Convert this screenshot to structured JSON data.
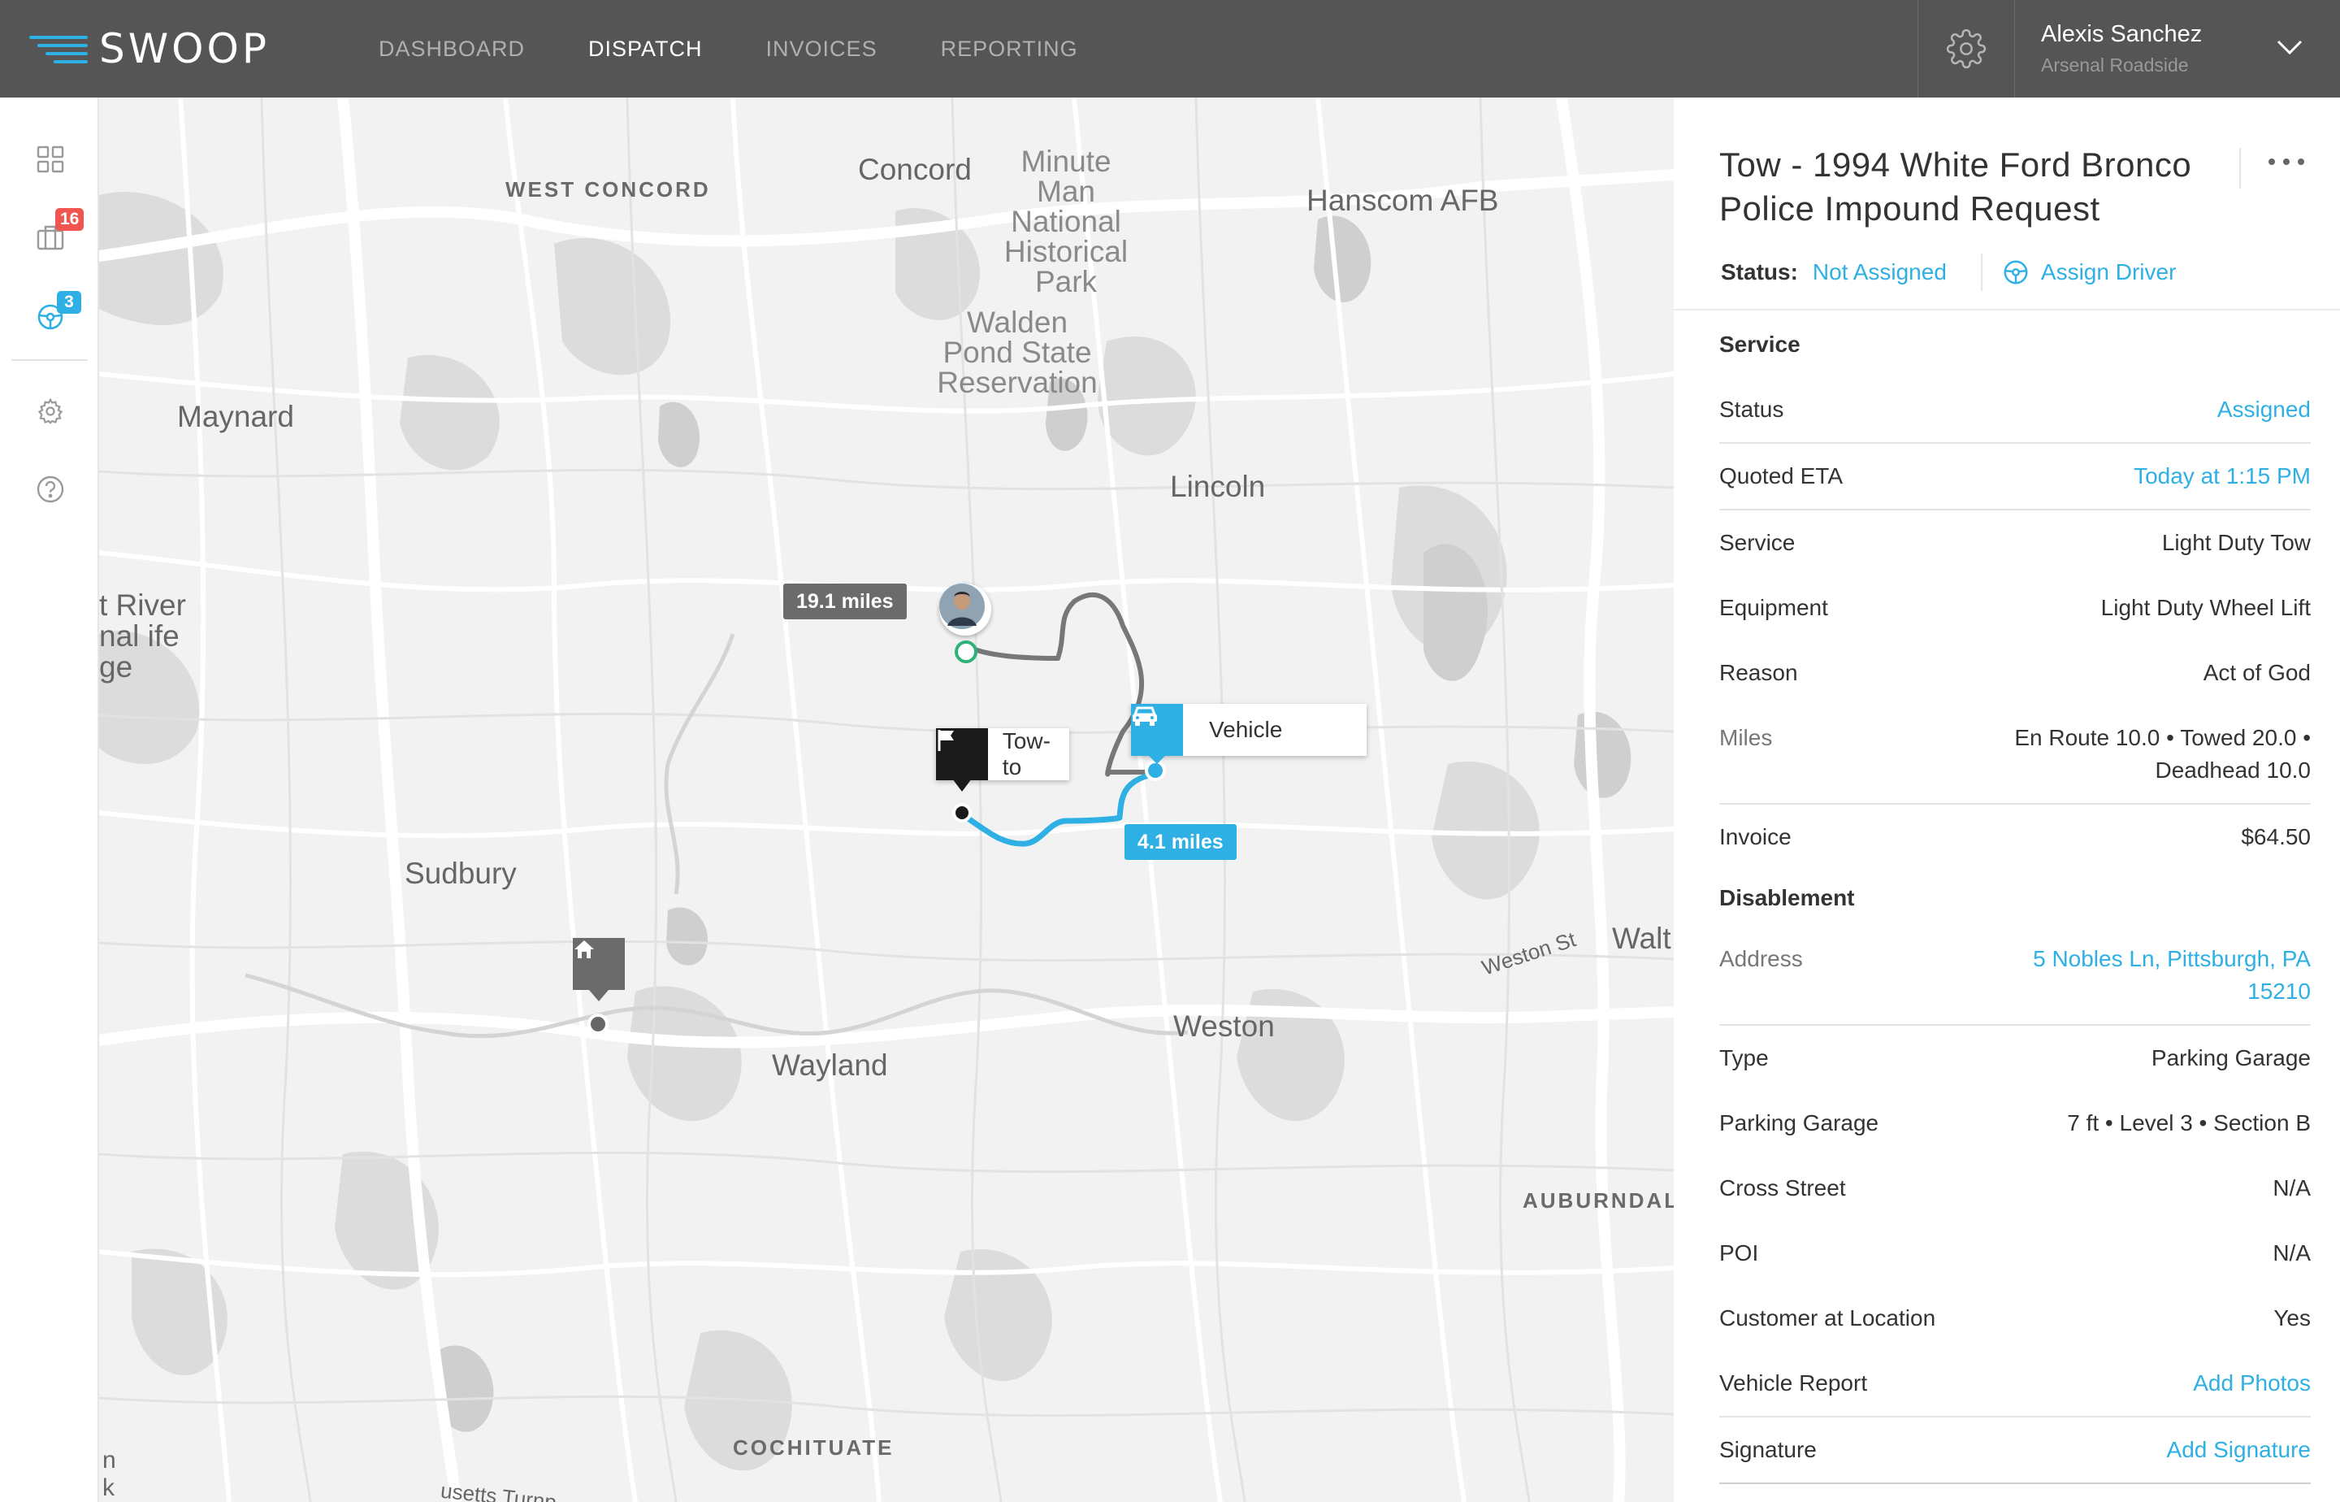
{
  "app": {
    "logo_text": "SWOOP"
  },
  "nav": {
    "items": [
      {
        "label": "DASHBOARD",
        "active": false
      },
      {
        "label": "DISPATCH",
        "active": true
      },
      {
        "label": "INVOICES",
        "active": false
      },
      {
        "label": "REPORTING",
        "active": false
      }
    ]
  },
  "user": {
    "name": "Alexis Sanchez",
    "company": "Arsenal Roadside"
  },
  "sidebar": {
    "badges": {
      "jobs": "16",
      "drivers": "3"
    },
    "icons": [
      "grid-icon",
      "briefcase-icon",
      "steering-wheel-icon",
      "settings-icon",
      "help-icon"
    ]
  },
  "map": {
    "labels": {
      "west_concord": "WEST CONCORD",
      "concord": "Concord",
      "minute_man": "Minute Man National Historical Park",
      "hanscom": "Hanscom AFB",
      "walden": "Walden Pond State Reservation",
      "maynard": "Maynard",
      "lincoln": "Lincoln",
      "river": "t River nal ife ge",
      "sudbury": "Sudbury",
      "weston_st": "Weston St",
      "walt": "Walt",
      "weston": "Weston",
      "wayland": "Wayland",
      "auburndale": "AUBURNDALE",
      "cochituate": "COCHITUATE",
      "setts_turnpike": "usetts Turnp",
      "edge_k": "k",
      "edge_n": "n"
    },
    "route_driver_miles": "19.1 miles",
    "route_tow_miles": "4.1 miles",
    "markers": {
      "tow_to": "Tow-to",
      "vehicle": "Vehicle"
    },
    "colors": {
      "route_driver": "#777777",
      "route_tow": "#2eb0e4",
      "driver_ring": "#2db37a"
    }
  },
  "job": {
    "title_line1": "Tow - 1994 White Ford Bronco",
    "title_line2": "Police Impound Request",
    "status_label": "Status:",
    "status_value": "Not Assigned",
    "assign_label": "Assign Driver"
  },
  "service": {
    "title": "Service",
    "rows": {
      "status": {
        "label": "Status",
        "value": "Assigned"
      },
      "eta": {
        "label": "Quoted ETA",
        "value": "Today at 1:15 PM"
      },
      "service": {
        "label": "Service",
        "value": "Light Duty Tow"
      },
      "equipment": {
        "label": "Equipment",
        "value": "Light Duty Wheel Lift"
      },
      "reason": {
        "label": "Reason",
        "value": "Act of God"
      },
      "miles": {
        "label": "Miles",
        "value": "En Route 10.0 • Towed 20.0 • Deadhead 10.0"
      },
      "invoice": {
        "label": "Invoice",
        "value": "$64.50"
      }
    }
  },
  "disablement": {
    "title": "Disablement",
    "rows": {
      "address": {
        "label": "Address",
        "value": "5 Nobles Ln, Pittsburgh, PA 15210"
      },
      "type": {
        "label": "Type",
        "value": "Parking Garage"
      },
      "parking": {
        "label": "Parking Garage",
        "value": "7 ft • Level 3 • Section B"
      },
      "cross": {
        "label": "Cross Street",
        "value": "N/A"
      },
      "poi": {
        "label": "POI",
        "value": "N/A"
      },
      "customer": {
        "label": "Customer at Location",
        "value": "Yes"
      },
      "report": {
        "label": "Vehicle Report",
        "value": "Add Photos"
      },
      "signature": {
        "label": "Signature",
        "value": "Add Signature"
      }
    }
  },
  "colors": {
    "accent": "#2eb0e4",
    "topbar": "#555555",
    "badge_red": "#f0554f",
    "badge_blue": "#2eb0e4"
  }
}
